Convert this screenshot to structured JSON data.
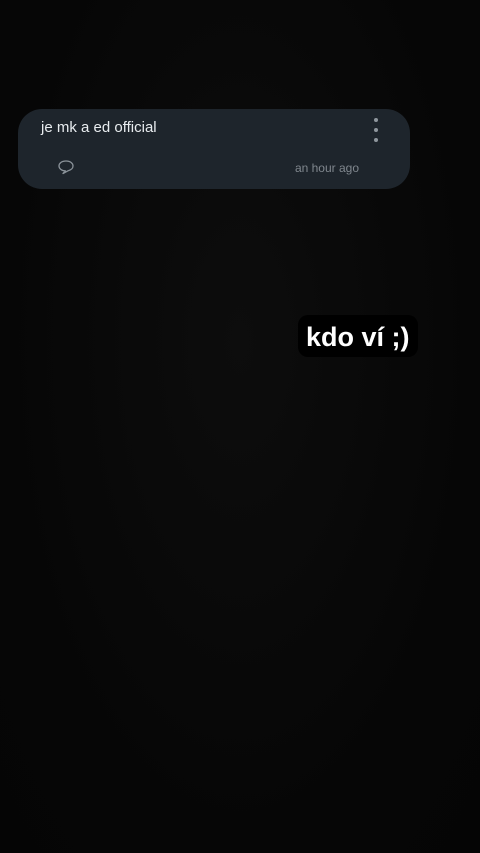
{
  "comment": {
    "text": "je mk a ed official",
    "time": "an hour ago",
    "reply_icon": "speech-bubble-icon",
    "menu_icon": "more-vertical-icon"
  },
  "caption": {
    "text": "kdo ví ;)"
  },
  "colors": {
    "background": "#070707",
    "card": "#1e252c",
    "caption_bg": "#000000"
  }
}
